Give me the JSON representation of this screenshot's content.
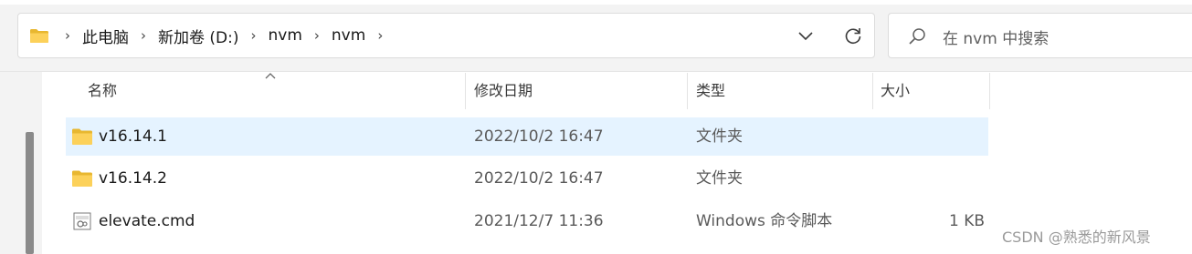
{
  "address": {
    "crumbs": [
      "此电脑",
      "新加卷 (D:)",
      "nvm",
      "nvm"
    ]
  },
  "search": {
    "placeholder": "在 nvm 中搜索"
  },
  "columns": {
    "name": "名称",
    "modified": "修改日期",
    "type": "类型",
    "size": "大小"
  },
  "files": [
    {
      "name": "v16.14.1",
      "modified": "2022/10/2 16:47",
      "type": "文件夹",
      "size": "",
      "icon": "folder-icon",
      "selected": true
    },
    {
      "name": "v16.14.2",
      "modified": "2022/10/2 16:47",
      "type": "文件夹",
      "size": "",
      "icon": "folder-icon",
      "selected": false
    },
    {
      "name": "elevate.cmd",
      "modified": "2021/12/7 11:36",
      "type": "Windows 命令脚本",
      "size": "1 KB",
      "icon": "cmd-file-icon",
      "selected": false
    }
  ],
  "watermark": "CSDN @熟悉的新风景",
  "colors": {
    "folder": "#f8c940",
    "selection": "#e5f3ff"
  }
}
